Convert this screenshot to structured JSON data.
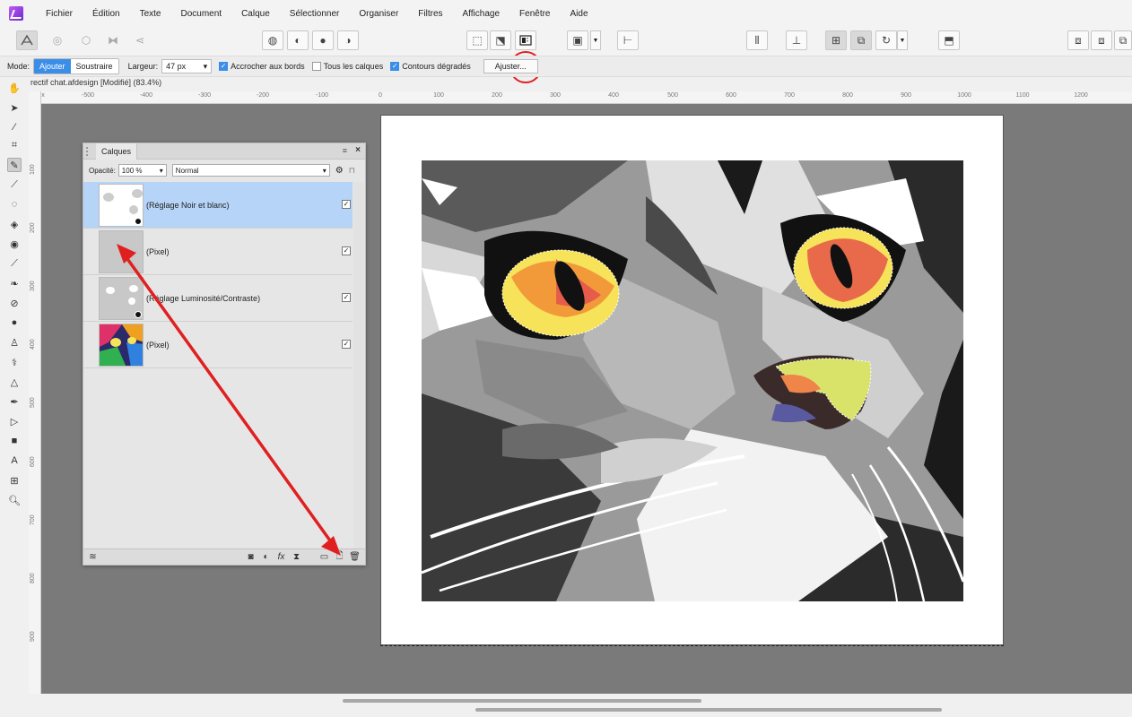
{
  "menu": [
    "Fichier",
    "Édition",
    "Texte",
    "Document",
    "Calque",
    "Sélectionner",
    "Organiser",
    "Filtres",
    "Affichage",
    "Fenêtre",
    "Aide"
  ],
  "context": {
    "mode_label": "Mode:",
    "mode_add": "Ajouter",
    "mode_subtract": "Soustraire",
    "width_label": "Largeur:",
    "width_value": "47 px",
    "snap_edges": "Accrocher aux bords",
    "all_layers": "Tous les calques",
    "soft_edges": "Contours dégradés",
    "refine_button": "Ajuster..."
  },
  "document_tab": "rectif chat.afdesign [Modifié] (83.4%)",
  "ruler": {
    "unit": "px",
    "top_ticks": [
      "-500",
      "-400",
      "-300",
      "-200",
      "-100",
      "0",
      "100",
      "200",
      "300",
      "400",
      "500",
      "600",
      "700",
      "800",
      "900",
      "1000",
      "1100",
      "1200"
    ],
    "left_ticks": [
      "100",
      "200",
      "300",
      "400",
      "500",
      "600",
      "700",
      "800",
      "900"
    ]
  },
  "layers_panel": {
    "tab_label": "Calques",
    "opacity_label": "Opacité:",
    "opacity_value": "100 %",
    "blend_mode": "Normal",
    "layers": [
      {
        "name": "(Réglage Noir et blanc)",
        "selected": true,
        "visible": true
      },
      {
        "name": "(Pixel)",
        "selected": false,
        "visible": true
      },
      {
        "name": "(Réglage Luminosité/Contraste)",
        "selected": false,
        "visible": true
      },
      {
        "name": "(Pixel)",
        "selected": false,
        "visible": true
      }
    ]
  },
  "colors": {
    "accent": "#3b8ee8",
    "annotation": "#e02020",
    "canvas_bg": "#7a7a7a",
    "selected_layer": "#b5d4f7"
  }
}
